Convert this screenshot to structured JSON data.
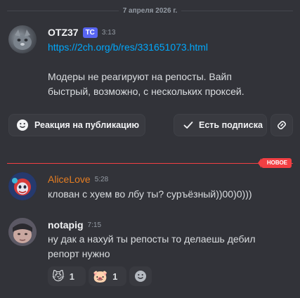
{
  "date_divider": "7 апреля 2026 г.",
  "messages": [
    {
      "username": "OTZ37",
      "tag": "ТС",
      "time": "3:13",
      "link": "https://2ch.org/b/res/331651073.html",
      "text_line1": "Модеры не реагируют на репосты. Вайп",
      "text_line2": "быстрый, возможно, с нескольких проксей."
    },
    {
      "username": "AliceLove",
      "time": "5:28",
      "text": "клован с хуем во лбу ты? суръёзный))00)0)))"
    },
    {
      "username": "notapig",
      "time": "7:15",
      "text_line1": "ну дак а нахуй ты репосты то делаешь дебил",
      "text_line2": "репорт нужно"
    }
  ],
  "actions": {
    "react_label": "Реакция на публикацию",
    "follow_label": "Есть подписка"
  },
  "new_badge": "НОВОЕ",
  "reactions": [
    {
      "emoji": "😼",
      "count": "1"
    },
    {
      "emoji": "🐷",
      "count": "1"
    }
  ],
  "colors": {
    "background": "#323339",
    "link": "#00a8fc",
    "alice_name": "#e67e22",
    "new_red": "#f23f43",
    "tag_bg": "#5865f2"
  }
}
